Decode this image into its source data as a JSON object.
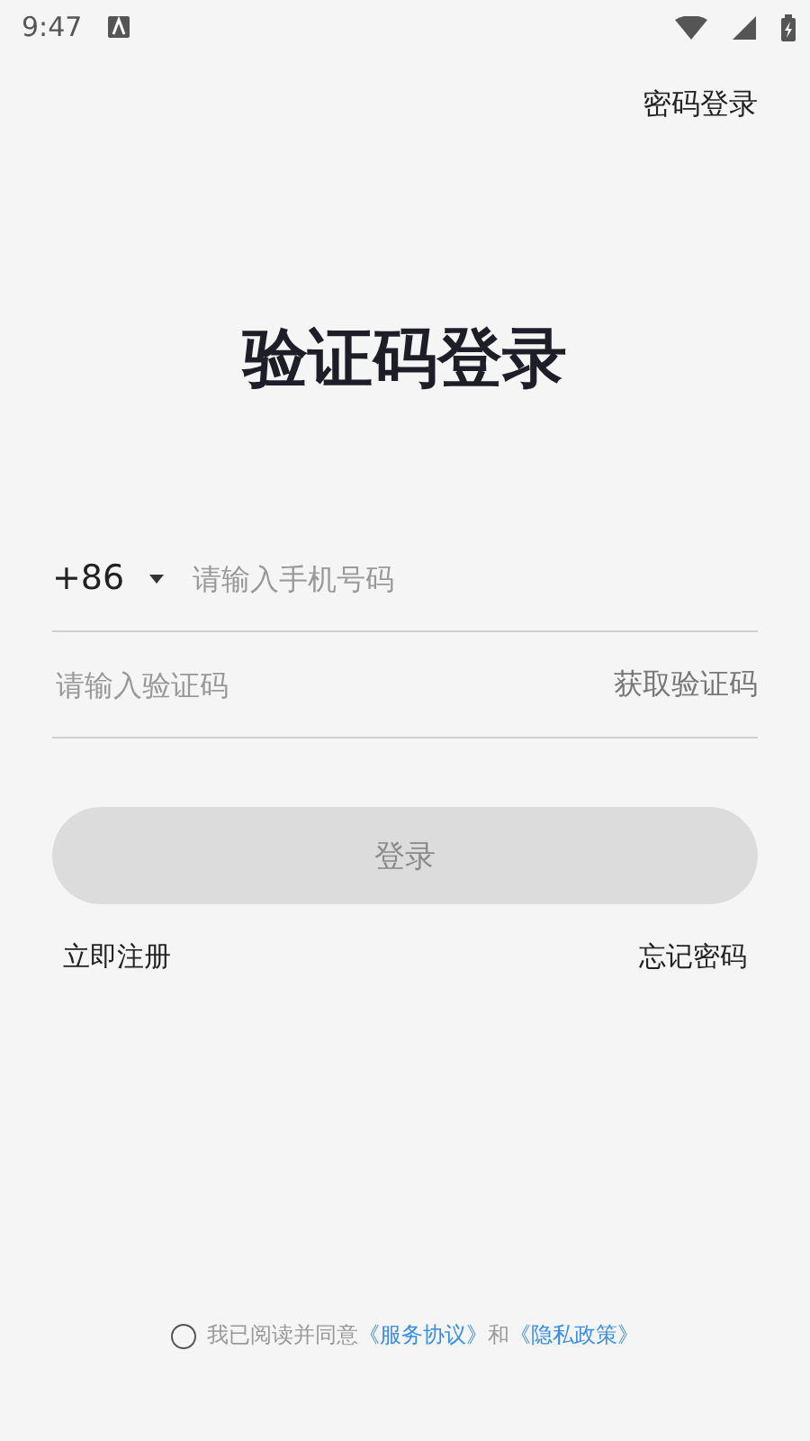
{
  "status_bar": {
    "time": "9:47"
  },
  "top_link": "密码登录",
  "title": "验证码登录",
  "phone": {
    "country_code": "+86",
    "placeholder": "请输入手机号码"
  },
  "code": {
    "placeholder": "请输入验证码",
    "action": "获取验证码"
  },
  "login_button": {
    "label": "登录",
    "disabled": true
  },
  "links": [
    "立即注册",
    "忘记密码"
  ],
  "agreement": {
    "checked": false,
    "prefix": "我已阅读并同意",
    "terms": "《服务协议》",
    "middle": "和",
    "privacy": "《隐私政策》"
  }
}
